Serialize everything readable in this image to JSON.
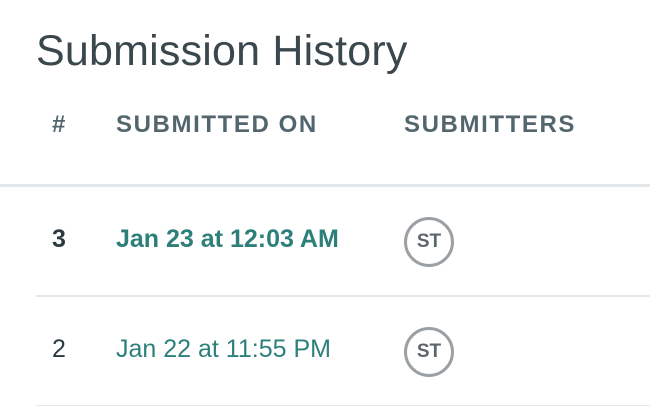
{
  "title": "Submission History",
  "columns": {
    "number": "#",
    "submitted_on": "SUBMITTED ON",
    "submitters": "SUBMITTERS"
  },
  "rows": [
    {
      "number": "3",
      "submitted_on": "Jan 23 at 12:03 AM",
      "submitter_initials": "ST",
      "emphasized": true
    },
    {
      "number": "2",
      "submitted_on": "Jan 22 at 11:55 PM",
      "submitter_initials": "ST",
      "emphasized": false
    }
  ],
  "colors": {
    "link": "#2d7f7a",
    "header_text": "#54666d",
    "title_text": "#3a474d",
    "avatar_border": "#9aa0a4"
  }
}
